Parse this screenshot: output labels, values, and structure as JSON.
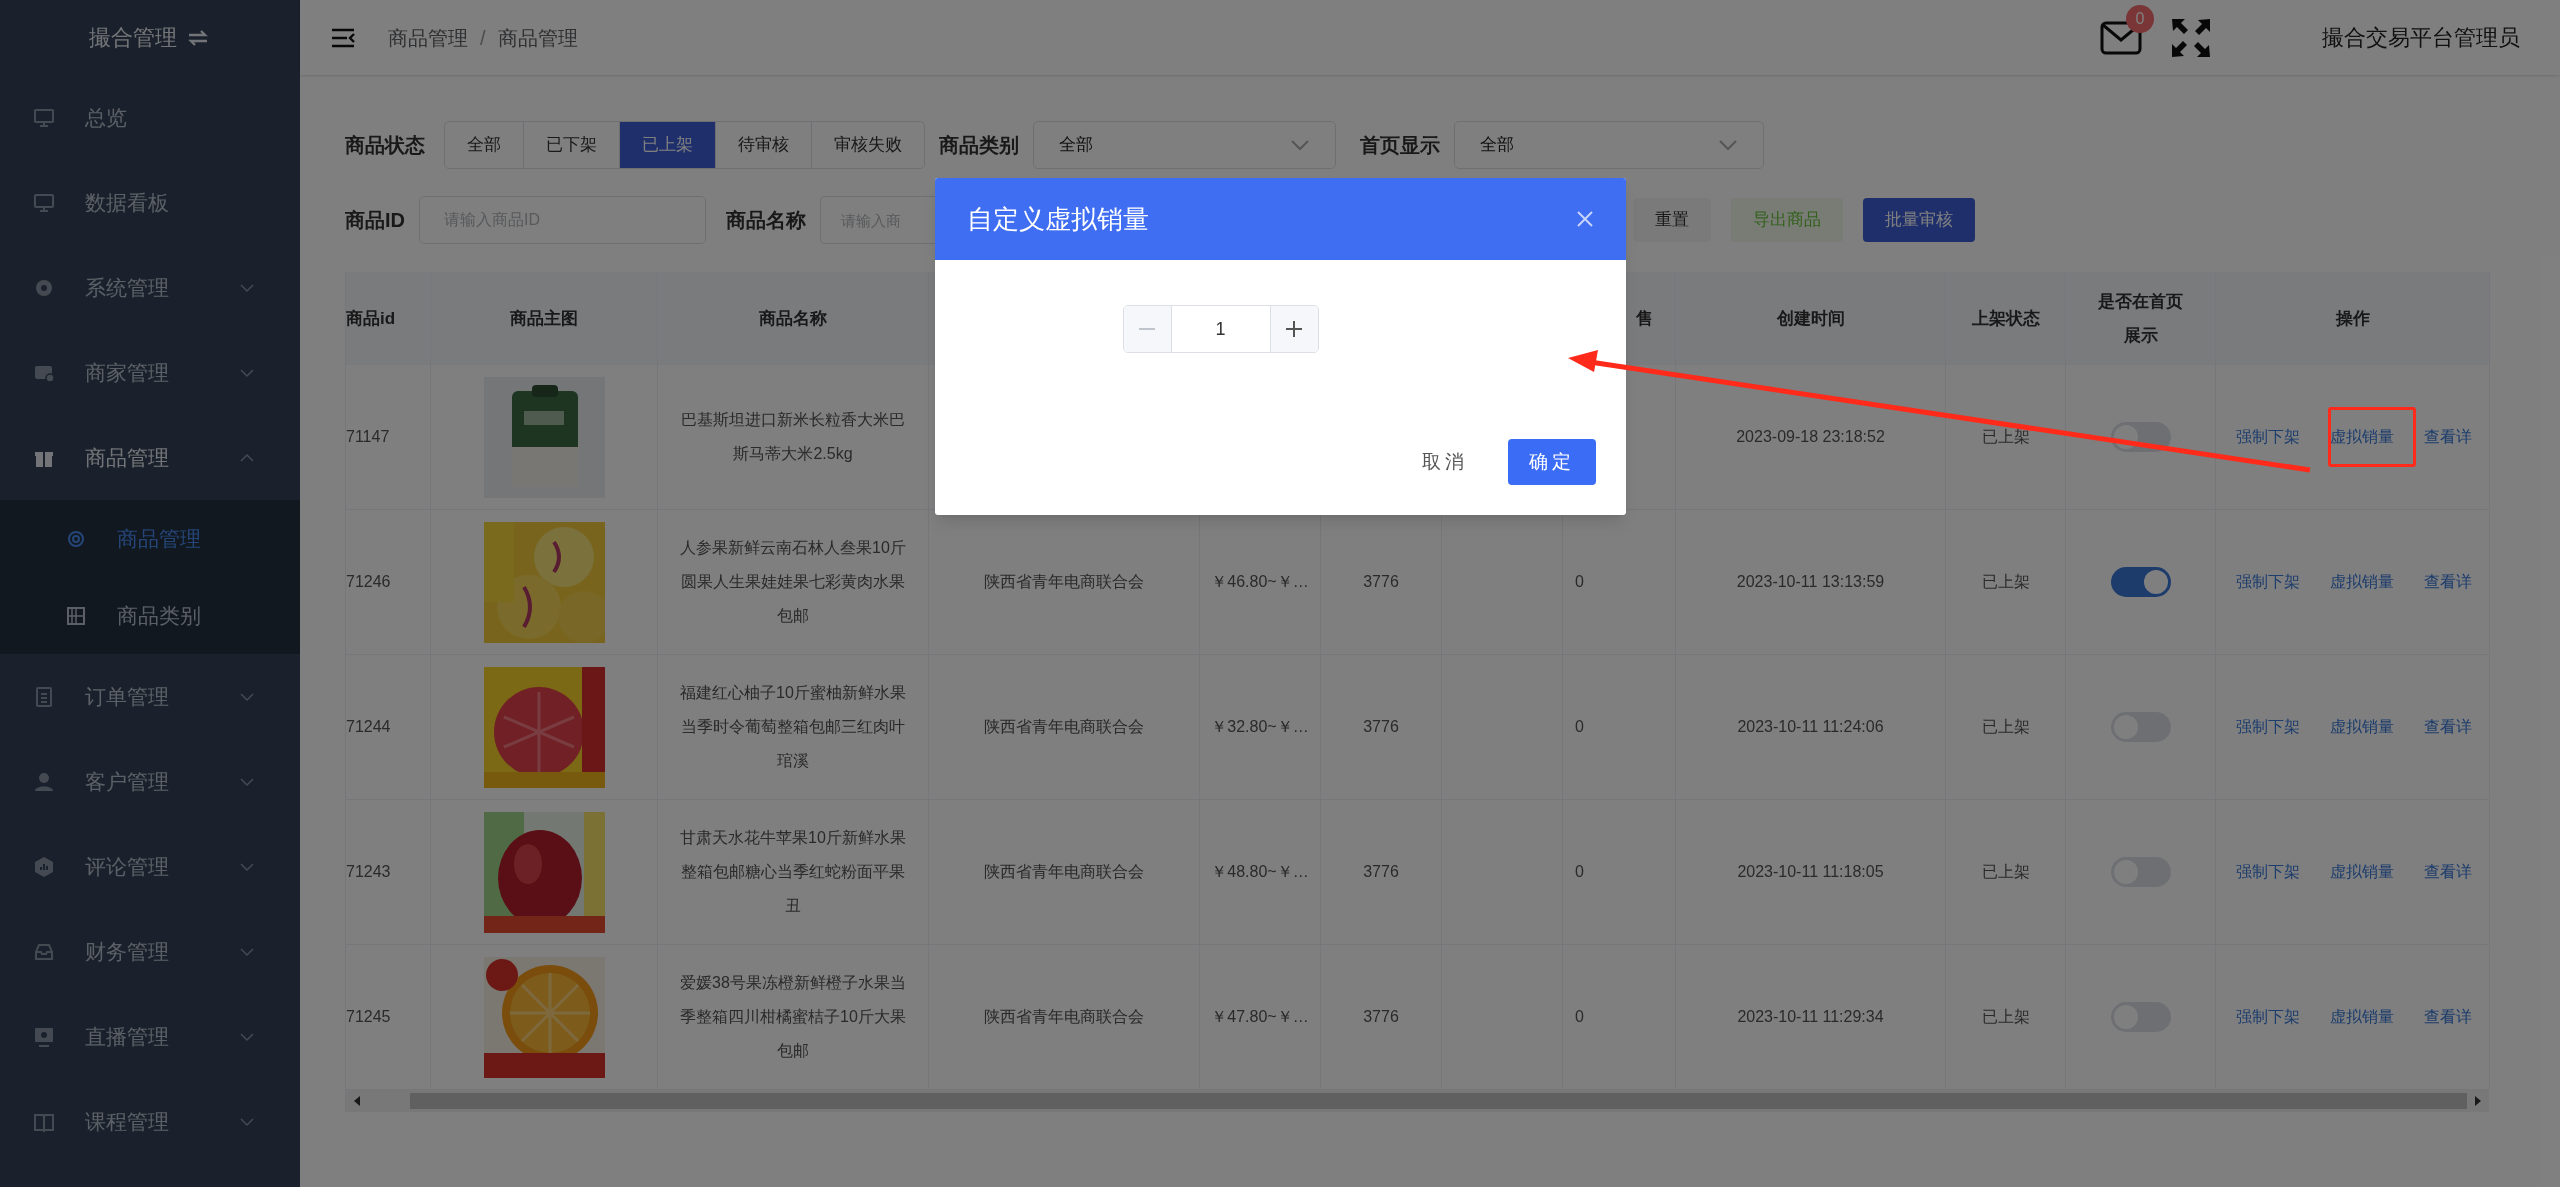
{
  "sidebar": {
    "title": "撮合管理",
    "items": [
      {
        "label": "总览",
        "kind": "link"
      },
      {
        "label": "数据看板",
        "kind": "link"
      },
      {
        "label": "系统管理",
        "kind": "group",
        "expanded": false
      },
      {
        "label": "商家管理",
        "kind": "group",
        "expanded": false
      },
      {
        "label": "商品管理",
        "kind": "group",
        "expanded": true,
        "children": [
          {
            "label": "商品管理",
            "selected": true
          },
          {
            "label": "商品类别",
            "selected": false
          }
        ]
      },
      {
        "label": "订单管理",
        "kind": "group",
        "expanded": false
      },
      {
        "label": "客户管理",
        "kind": "group",
        "expanded": false
      },
      {
        "label": "评论管理",
        "kind": "group",
        "expanded": false
      },
      {
        "label": "财务管理",
        "kind": "group",
        "expanded": false
      },
      {
        "label": "直播管理",
        "kind": "group",
        "expanded": false
      },
      {
        "label": "课程管理",
        "kind": "group",
        "expanded": false
      }
    ]
  },
  "header": {
    "breadcrumb": [
      "商品管理",
      "商品管理"
    ],
    "separator": "/",
    "mail_badge": "0",
    "user_name": "撮合交易平台管理员"
  },
  "filters": {
    "status": {
      "label": "商品状态",
      "options": [
        {
          "label": "全部",
          "selected": false
        },
        {
          "label": "已下架",
          "selected": false
        },
        {
          "label": "已上架",
          "selected": true
        },
        {
          "label": "待审核",
          "selected": false
        },
        {
          "label": "审核失败",
          "selected": false
        }
      ]
    },
    "category": {
      "label": "商品类别",
      "value": "全部"
    },
    "homepage": {
      "label": "首页显示",
      "value": "全部"
    },
    "product_id": {
      "label": "商品ID",
      "placeholder": "请输入商品ID"
    },
    "product_name": {
      "label": "商品名称",
      "placeholder": "请输入商"
    },
    "buttons": [
      {
        "label": "重置",
        "kind": "plain"
      },
      {
        "label": "导出商品",
        "kind": "success"
      },
      {
        "label": "批量审核",
        "kind": "primary"
      }
    ]
  },
  "table": {
    "columns": [
      {
        "label": "商品id"
      },
      {
        "label": "商品主图"
      },
      {
        "label": "商品名称"
      },
      {},
      {},
      {},
      {},
      {
        "label": "售"
      },
      {
        "label": "创建时间"
      },
      {
        "label": "上架状态"
      },
      {
        "label": "是否在首页展示"
      },
      {
        "label": "操作"
      }
    ],
    "rows": [
      {
        "id": "71147",
        "name": "巴基斯坦进口新米长粒香大米巴斯马蒂大米2.5kg",
        "created": "2023-09-18 23:18:52",
        "status": "已上架",
        "home_display": false,
        "actions": [
          "强制下架",
          "虚拟销量",
          "查看详"
        ]
      },
      {
        "id": "71246",
        "name": "人参果新鲜云南石林人叁果10斤圆果人生果娃娃果七彩黄肉水果包邮",
        "merchant": "陕西省青年电商联合会",
        "price": "￥46.80~￥…",
        "stock": "3776",
        "sales": "0",
        "created": "2023-10-11 13:13:59",
        "status": "已上架",
        "home_display": true,
        "actions": [
          "强制下架",
          "虚拟销量",
          "查看详"
        ]
      },
      {
        "id": "71244",
        "name": "福建红心柚子10斤蜜柚新鲜水果当季时令葡萄整箱包邮三红肉叶琯溪",
        "merchant": "陕西省青年电商联合会",
        "price": "￥32.80~￥…",
        "stock": "3776",
        "sales": "0",
        "created": "2023-10-11 11:24:06",
        "status": "已上架",
        "home_display": false,
        "actions": [
          "强制下架",
          "虚拟销量",
          "查看详"
        ]
      },
      {
        "id": "71243",
        "name": "甘肃天水花牛苹果10斤新鲜水果整箱包邮糖心当季红蛇粉面平果丑",
        "merchant": "陕西省青年电商联合会",
        "price": "￥48.80~￥…",
        "stock": "3776",
        "sales": "0",
        "created": "2023-10-11 11:18:05",
        "status": "已上架",
        "home_display": false,
        "actions": [
          "强制下架",
          "虚拟销量",
          "查看详"
        ]
      },
      {
        "id": "71245",
        "name": "爱媛38号果冻橙新鲜橙子水果当季整箱四川柑橘蜜桔子10斤大果包邮",
        "merchant": "陕西省青年电商联合会",
        "price": "￥47.80~￥…",
        "stock": "3776",
        "sales": "0",
        "created": "2023-10-11 11:29:34",
        "status": "已上架",
        "home_display": false,
        "actions": [
          "强制下架",
          "虚拟销量",
          "查看详"
        ]
      }
    ]
  },
  "dialog": {
    "title": "自定义虚拟销量",
    "value": "1",
    "decrease_disabled": true,
    "cancel": "取消",
    "confirm": "确定"
  }
}
